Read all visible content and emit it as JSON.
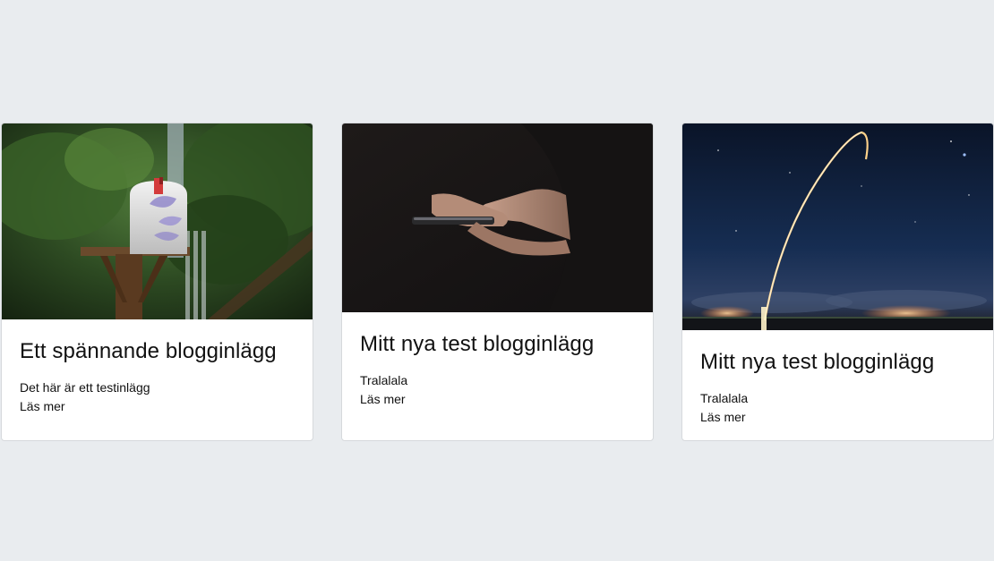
{
  "posts": [
    {
      "title": "Ett spännande blogginlägg",
      "excerpt": "Det här är ett testinlägg",
      "read_more": "Läs mer",
      "image_icon": "mailbox-photo"
    },
    {
      "title": "Mitt nya test blogginlägg",
      "excerpt": "Tralalala",
      "read_more": "Läs mer",
      "image_icon": "smartphone-hands-photo"
    },
    {
      "title": "Mitt nya test blogginlägg",
      "excerpt": "Tralalala",
      "read_more": "Läs mer",
      "image_icon": "rocket-launch-photo"
    }
  ],
  "colors": {
    "page_background": "#e9ecef",
    "card_background": "#ffffff",
    "text": "#111111"
  }
}
